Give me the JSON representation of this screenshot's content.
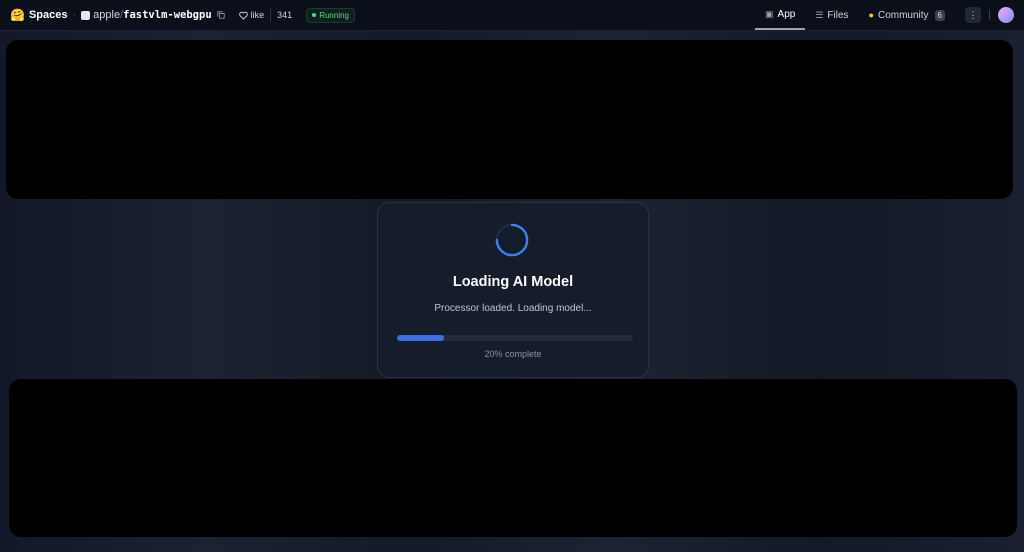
{
  "header": {
    "brand": "Spaces",
    "logo_icon": "hugging-face-icon",
    "owner": "apple",
    "separator": "/",
    "space_name": "fastvlm-webgpu",
    "like_label": "like",
    "like_count": "341",
    "status": "Running",
    "status_color": "#4ade80"
  },
  "tabs": [
    {
      "label": "App",
      "icon": "app-icon"
    },
    {
      "label": "Files",
      "icon": "files-icon"
    },
    {
      "label": "Community",
      "icon": "community-icon",
      "badge": "6"
    }
  ],
  "loading": {
    "title": "Loading AI Model",
    "status": "Processor loaded. Loading model...",
    "progress": 0.2,
    "progress_label": "20% complete",
    "accent_color": "#3b6fe0"
  }
}
